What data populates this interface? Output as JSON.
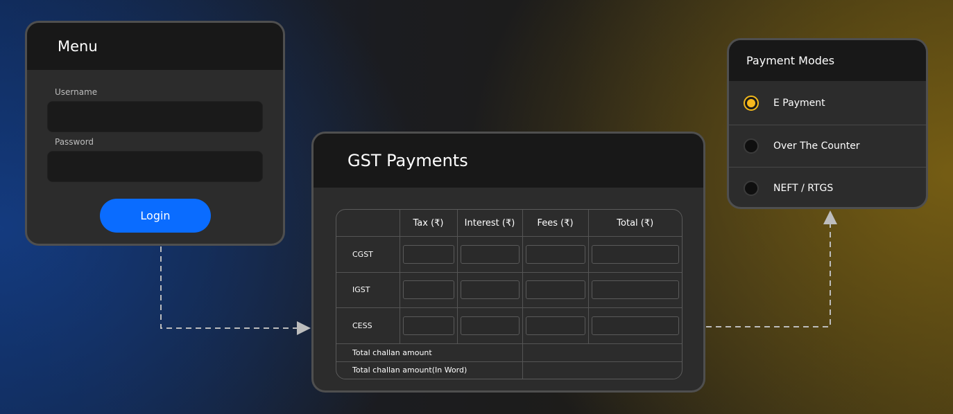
{
  "login": {
    "title": "Menu",
    "username_label": "Username",
    "password_label": "Password",
    "login_button": "Login"
  },
  "gst": {
    "title": "GST Payments",
    "columns": [
      "",
      "Tax (₹)",
      "Interest (₹)",
      "Fees (₹)",
      "Total (₹)"
    ],
    "rows": [
      "CGST",
      "IGST",
      "CESS"
    ],
    "total_challan_label": "Total challan amount",
    "total_challan_words_label": "Total challan amount(In Word)"
  },
  "payment_modes": {
    "title": "Payment Modes",
    "options": [
      {
        "label": "E Payment",
        "selected": true
      },
      {
        "label": "Over The Counter",
        "selected": false
      },
      {
        "label": "NEFT / RTGS",
        "selected": false
      }
    ],
    "accent_color": "#f6b81e"
  },
  "colors": {
    "login_button": "#0a6cff",
    "panel_bg": "#2c2c2c",
    "header_bg": "#181818"
  }
}
